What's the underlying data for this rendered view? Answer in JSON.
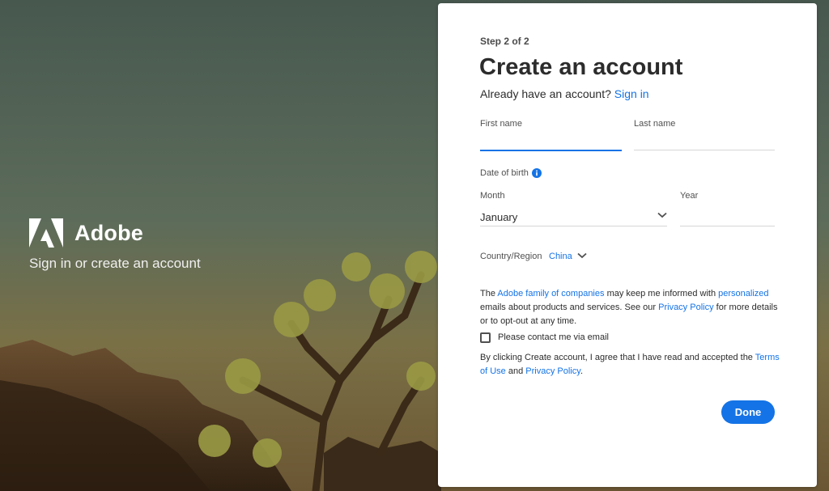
{
  "brand": {
    "name": "Adobe",
    "tagline": "Sign in or create an account",
    "logo_icon": "adobe-logo-icon"
  },
  "form": {
    "step": "Step 2 of 2",
    "title": "Create an account",
    "have_account_text": "Already have an account?",
    "sign_in_link": "Sign in",
    "first_name": {
      "label": "First name",
      "value": ""
    },
    "last_name": {
      "label": "Last name",
      "value": ""
    },
    "dob": {
      "label": "Date of birth",
      "info_icon": "info-icon",
      "month_label": "Month",
      "month_value": "January",
      "year_label": "Year",
      "year_value": ""
    },
    "country": {
      "label": "Country/Region",
      "value": "China"
    },
    "consent": {
      "part1": "The",
      "link_family": "Adobe family of companies",
      "part2": "may keep me informed with",
      "link_personalized": "personalized",
      "part3": "emails about products and services. See our",
      "link_privacy": "Privacy Policy",
      "part4": "for more details or to opt-out at any time."
    },
    "contact_checkbox": {
      "label": "Please contact me via email",
      "checked": false
    },
    "terms": {
      "part1": "By clicking Create account, I agree that I have read and accepted the",
      "link_terms": "Terms of Use",
      "part2": "and",
      "link_privacy": "Privacy Policy",
      "part3": "."
    },
    "done_label": "Done"
  },
  "colors": {
    "accent": "#1473e6",
    "text": "#2c2c2c",
    "card_bg": "#ffffff"
  }
}
